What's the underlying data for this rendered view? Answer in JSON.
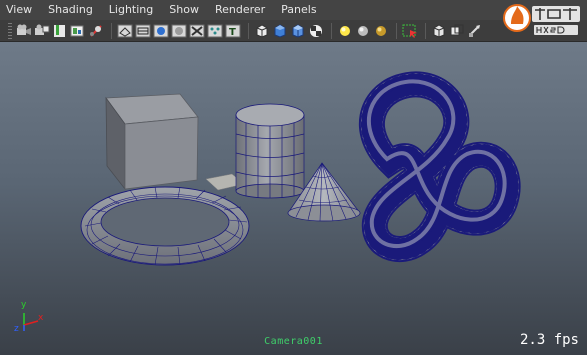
{
  "menu": [
    "View",
    "Shading",
    "Lighting",
    "Show",
    "Renderer",
    "Panels"
  ],
  "toolbar": {
    "icons": [
      "camera-select-icon",
      "camera-attributes-icon",
      "bookmark-icon",
      "image-plane-icon",
      "grid-toggle-icon",
      "wireframe-icon",
      "smooth-shade-icon",
      "textured-icon",
      "lights-icon",
      "shadows-icon",
      "xray-icon",
      "text-icon",
      "cube-wire-icon",
      "cube-shaded-icon",
      "cube-blue-icon",
      "checker-icon",
      "light-yellow-icon",
      "light-grey-icon",
      "light-gold-icon",
      "select-camera-icon",
      "isolate-icon",
      "frame-icon",
      "film-gate-icon"
    ]
  },
  "viewport": {
    "camera_label": "Camera001",
    "fps": "2.3 fps",
    "axes": {
      "x": "x",
      "y": "y",
      "z": "z"
    }
  },
  "watermark": {
    "brand": "火星网",
    "url": "hxsd.com"
  },
  "colors": {
    "wire": "#1a1a7a",
    "surface": "#8c8f96",
    "camera_label": "#3fcf6a"
  }
}
